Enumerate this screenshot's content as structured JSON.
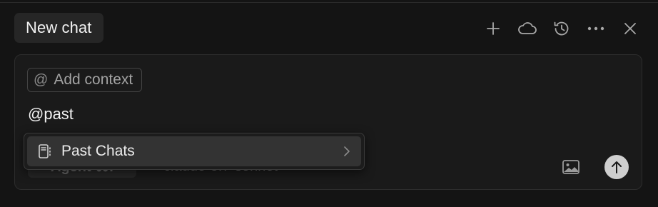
{
  "header": {
    "tab_title": "New chat",
    "actions": [
      {
        "icon": "plus-icon"
      },
      {
        "icon": "cloud-icon"
      },
      {
        "icon": "history-icon"
      },
      {
        "icon": "more-icon"
      },
      {
        "icon": "close-icon"
      }
    ]
  },
  "composer": {
    "add_context_icon": "@",
    "add_context_label": "Add context",
    "input_value": "@past",
    "mode_label": "Agent ⌘I",
    "model_label": "claude-3.7-sonnet"
  },
  "mention_menu": {
    "items": [
      {
        "label": "Past Chats",
        "icon": "notebook-icon",
        "has_submenu": true
      }
    ]
  },
  "colors": {
    "background": "#141414",
    "panel": "#1a1a1a",
    "send_button": "#cfcfcf"
  }
}
